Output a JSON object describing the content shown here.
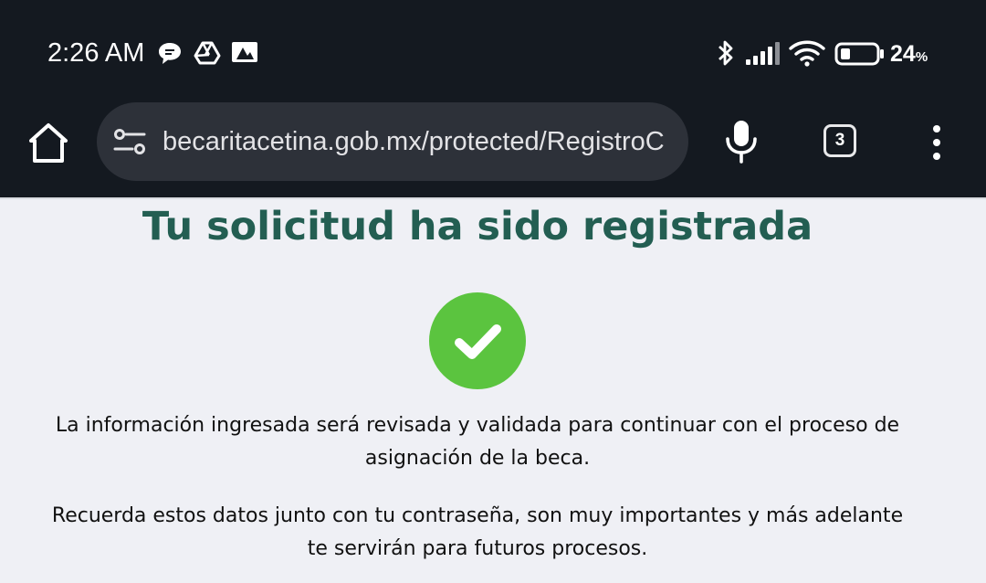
{
  "status_bar": {
    "time": "2:26 AM",
    "battery_percent": "24",
    "battery_percent_sign": "%",
    "icons": [
      "chat-bubble-icon",
      "drive-icon",
      "notification-image-icon",
      "bluetooth-icon",
      "cell-signal-icon",
      "wifi-icon",
      "battery-icon"
    ]
  },
  "browser": {
    "url": "becaritacetina.gob.mx/protected/RegistroC",
    "tab_count": "3",
    "icons": [
      "home-icon",
      "site-settings-icon",
      "mic-icon",
      "tabs-icon",
      "overflow-menu-icon"
    ]
  },
  "page": {
    "title": "Tu solicitud ha sido registrada",
    "success_icon": "check-circle-icon",
    "paragraph_1_line_1": "La información ingresada será revisada y validada para continuar con el proceso de",
    "paragraph_1_line_2": "asignación de la beca.",
    "paragraph_2_line_1": "Recuerda estos datos junto con tu contraseña, son muy importantes y más adelante",
    "paragraph_2_line_2": "te servirán para futuros procesos."
  },
  "colors": {
    "top_bar_bg": "#141920",
    "url_bar_bg": "#2d3139",
    "page_bg": "#eff0f5",
    "title_color": "#235e52",
    "success_green": "#5bc43f"
  }
}
